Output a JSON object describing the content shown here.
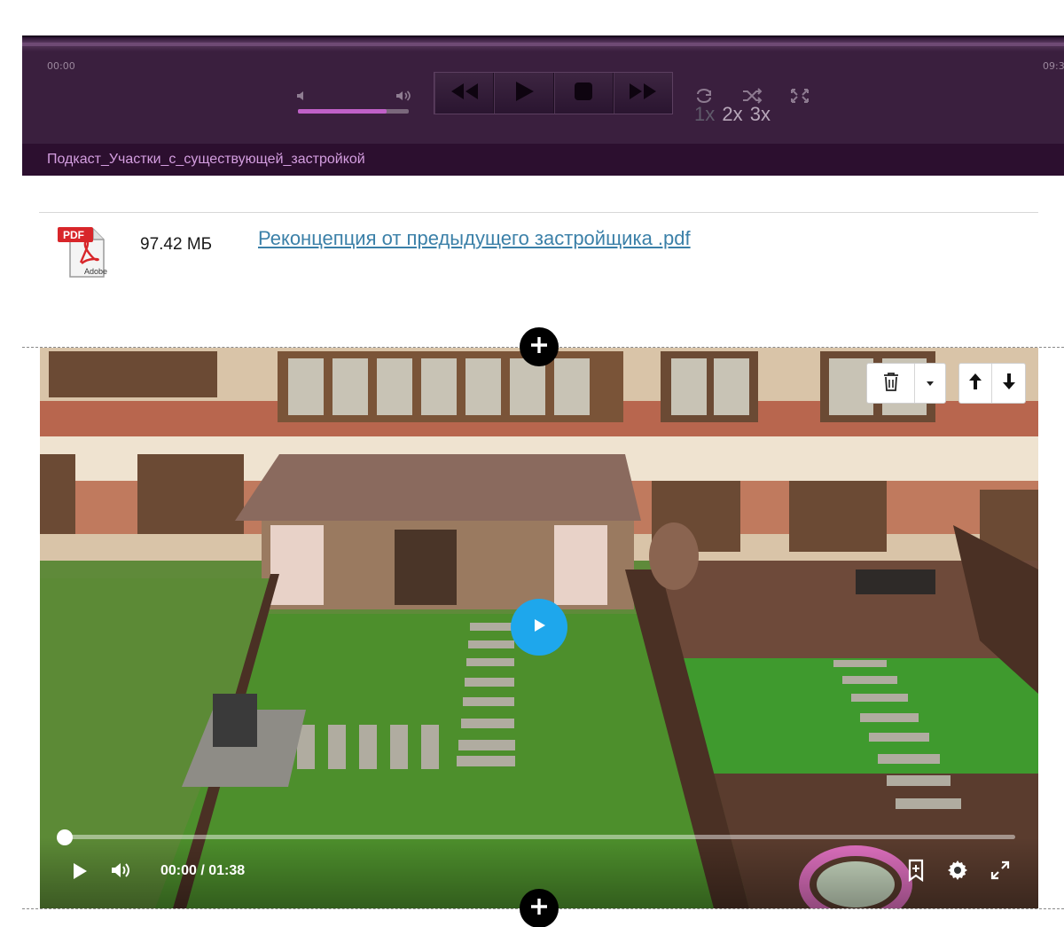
{
  "audio_player": {
    "time_start": "00:00",
    "time_end": "09:3",
    "volume_level": 0.8,
    "title": "Подкаст_Участки_с_существующей_застройкой",
    "speeds": [
      "1x",
      "2x",
      "3x"
    ],
    "active_speed": "1x",
    "icons": {
      "mute": "speaker-mute-icon",
      "volume": "speaker-loud-icon",
      "rewind": "rewind-icon",
      "play": "play-icon",
      "stop": "stop-icon",
      "forward": "fast-forward-icon",
      "repeat": "repeat-icon",
      "shuffle": "shuffle-icon",
      "fullscreen": "fullscreen-icon"
    },
    "colors": {
      "background": "#3a1f3e",
      "title_bar": "#2c0f2f",
      "title_text": "#d49ee0",
      "volume_fill": "#c060c8"
    }
  },
  "attachment": {
    "icon": "pdf-file-icon",
    "icon_label": "PDF",
    "icon_brand": "Adobe",
    "size": "97.42 МБ",
    "file_name": "Реконцепция от предыдущего застройщика .pdf",
    "link_color": "#3b80a8"
  },
  "video_block": {
    "toolbar": {
      "delete_icon": "trash-icon",
      "dropdown_icon": "caret-down-icon",
      "move_up_icon": "arrow-up-icon",
      "move_down_icon": "arrow-down-icon"
    },
    "add_block_icon": "plus-icon",
    "big_play_icon": "play-icon",
    "big_play_color": "#1ea7ec",
    "time_display": "00:00 / 01:38",
    "progress": 0.0,
    "controls": {
      "play": "play-icon",
      "volume": "volume-icon",
      "bookmark": "bookmark-icon",
      "settings": "gear-icon",
      "fullscreen": "fullscreen-icon"
    }
  }
}
